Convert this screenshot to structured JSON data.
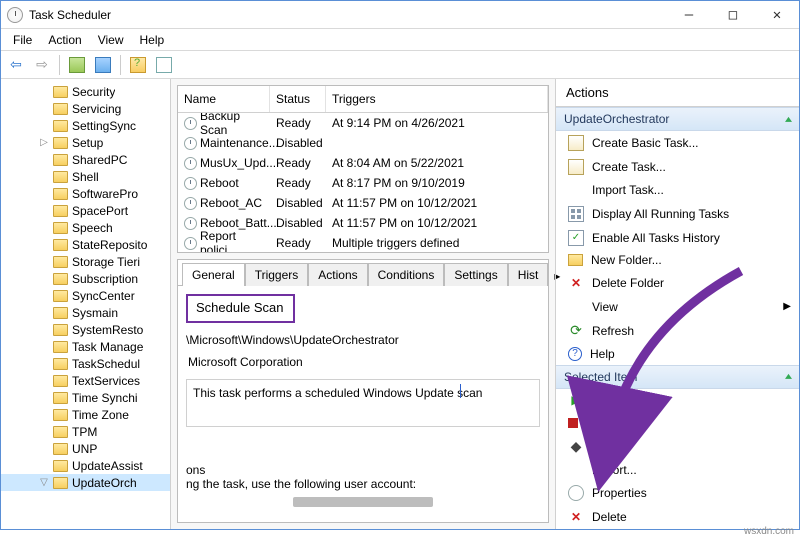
{
  "window": {
    "title": "Task Scheduler"
  },
  "menu": {
    "file": "File",
    "action": "Action",
    "view": "View",
    "help": "Help"
  },
  "tree": {
    "items": [
      {
        "label": "Security"
      },
      {
        "label": "Servicing"
      },
      {
        "label": "SettingSync"
      },
      {
        "label": "Setup",
        "has_child": true
      },
      {
        "label": "SharedPC"
      },
      {
        "label": "Shell"
      },
      {
        "label": "SoftwarePro"
      },
      {
        "label": "SpacePort"
      },
      {
        "label": "Speech"
      },
      {
        "label": "StateReposito"
      },
      {
        "label": "Storage Tieri"
      },
      {
        "label": "Subscription"
      },
      {
        "label": "SyncCenter"
      },
      {
        "label": "Sysmain"
      },
      {
        "label": "SystemResto"
      },
      {
        "label": "Task Manage"
      },
      {
        "label": "TaskSchedul"
      },
      {
        "label": "TextServices"
      },
      {
        "label": "Time Synchi"
      },
      {
        "label": "Time Zone"
      },
      {
        "label": "TPM"
      },
      {
        "label": "UNP"
      },
      {
        "label": "UpdateAssist"
      },
      {
        "label": "UpdateOrch",
        "selected": true,
        "has_child": true,
        "expanded": true
      }
    ]
  },
  "task_list": {
    "columns": {
      "name": "Name",
      "status": "Status",
      "triggers": "Triggers"
    },
    "rows": [
      {
        "name": "Backup Scan",
        "status": "Ready",
        "trigger": "At 9:14 PM on 4/26/2021"
      },
      {
        "name": "Maintenance...",
        "status": "Disabled",
        "trigger": ""
      },
      {
        "name": "MusUx_Upd...",
        "status": "Ready",
        "trigger": "At 8:04 AM on 5/22/2021"
      },
      {
        "name": "Reboot",
        "status": "Ready",
        "trigger": "At 8:17 PM on 9/10/2019"
      },
      {
        "name": "Reboot_AC",
        "status": "Disabled",
        "trigger": "At 11:57 PM on 10/12/2021"
      },
      {
        "name": "Reboot_Batt...",
        "status": "Disabled",
        "trigger": "At 11:57 PM on 10/12/2021"
      },
      {
        "name": "Report polici",
        "status": "Ready",
        "trigger": "Multiple triggers defined"
      }
    ]
  },
  "detail": {
    "tabs": {
      "general": "General",
      "triggers": "Triggers",
      "actions": "Actions",
      "conditions": "Conditions",
      "settings": "Settings",
      "history": "Hist"
    },
    "task_name": "Schedule Scan",
    "location": "\\Microsoft\\Windows\\UpdateOrchestrator",
    "author": "Microsoft Corporation",
    "description": "This task performs a scheduled Windows Update scan",
    "options_hint_fragment": "ons",
    "user_hint_fragment": "ng the task, use the following user account:"
  },
  "actions": {
    "title": "Actions",
    "group1": {
      "header": "UpdateOrchestrator",
      "create_basic": "Create Basic Task...",
      "create": "Create Task...",
      "import": "Import Task...",
      "display_all": "Display All Running Tasks",
      "enable_history": "Enable All Tasks History",
      "new_folder": "New Folder...",
      "delete_folder": "Delete Folder",
      "view": "View",
      "refresh": "Refresh",
      "help": "Help"
    },
    "group2": {
      "header": "Selected Item",
      "run": "Run",
      "end": "End",
      "disable": "Disable",
      "export": "Export...",
      "properties": "Properties",
      "delete": "Delete"
    }
  },
  "watermark": "wsxdn.com"
}
